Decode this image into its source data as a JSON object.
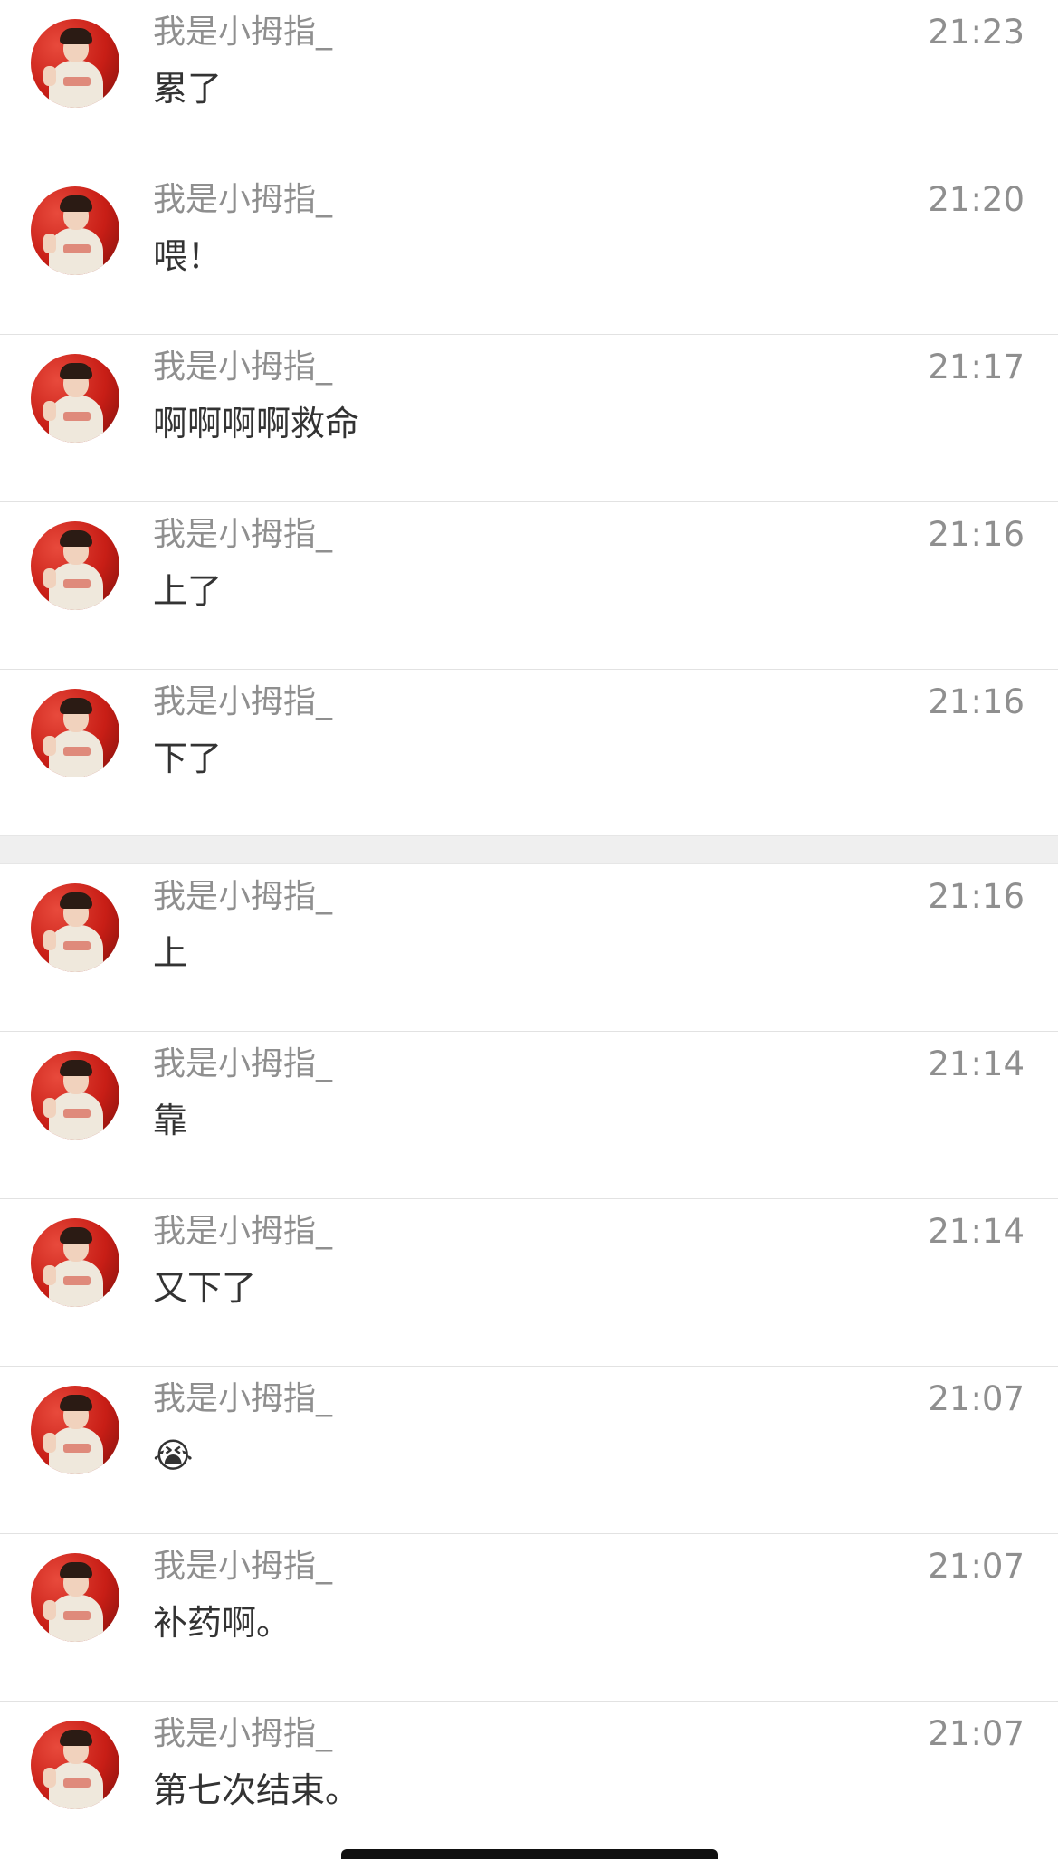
{
  "group1": [
    {
      "name": "我是小拇指_",
      "time": "21:23",
      "message": "累了"
    },
    {
      "name": "我是小拇指_",
      "time": "21:20",
      "message": "喂！"
    },
    {
      "name": "我是小拇指_",
      "time": "21:17",
      "message": "啊啊啊啊救命"
    },
    {
      "name": "我是小拇指_",
      "time": "21:16",
      "message": "上了"
    },
    {
      "name": "我是小拇指_",
      "time": "21:16",
      "message": "下了"
    }
  ],
  "group2": [
    {
      "name": "我是小拇指_",
      "time": "21:16",
      "message": "上"
    },
    {
      "name": "我是小拇指_",
      "time": "21:14",
      "message": "靠"
    },
    {
      "name": "我是小拇指_",
      "time": "21:14",
      "message": "又下了"
    },
    {
      "name": "我是小拇指_",
      "time": "21:07",
      "message": "😭"
    },
    {
      "name": "我是小拇指_",
      "time": "21:07",
      "message": "补药啊。"
    },
    {
      "name": "我是小拇指_",
      "time": "21:07",
      "message": "第七次结束。"
    }
  ],
  "avatar_icon": "user-avatar-icon",
  "colors": {
    "name_text": "#8f8f8f",
    "time_text": "#8f8f8f",
    "message_text": "#333333",
    "separator": "#efefef",
    "divider": "#e2e2e2",
    "avatar_bg": "#c81e16"
  }
}
